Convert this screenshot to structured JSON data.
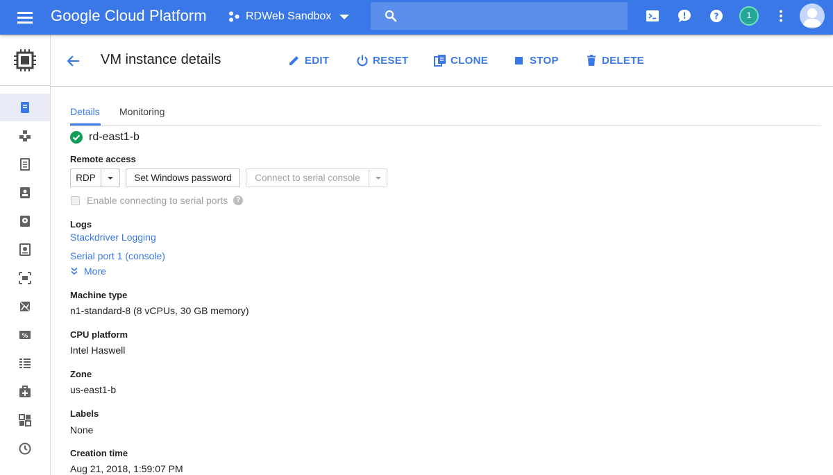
{
  "topbar": {
    "brand": "Google Cloud Platform",
    "project": "RDWeb Sandbox",
    "notification_count": "1",
    "color": "#3b78e7"
  },
  "rail": {
    "items": [
      {
        "icon": "vm-instances-icon",
        "active": true
      },
      {
        "icon": "instance-groups-icon"
      },
      {
        "icon": "instance-templates-icon"
      },
      {
        "icon": "sole-tenant-nodes-icon"
      },
      {
        "icon": "disks-icon"
      },
      {
        "icon": "snapshots-icon"
      },
      {
        "icon": "images-icon"
      },
      {
        "icon": "tpus-icon"
      },
      {
        "icon": "committed-use-discounts-icon"
      },
      {
        "icon": "metadata-icon"
      },
      {
        "icon": "health-checks-icon"
      },
      {
        "icon": "zones-icon"
      },
      {
        "icon": "operations-icon"
      }
    ]
  },
  "header": {
    "title": "VM instance details",
    "actions": {
      "edit": "EDIT",
      "reset": "RESET",
      "clone": "CLONE",
      "stop": "STOP",
      "delete": "DELETE"
    }
  },
  "tabs": {
    "details": "Details",
    "monitoring": "Monitoring"
  },
  "instance": {
    "name": "rd-east1-b",
    "status_color": "#0f9d58"
  },
  "remote_access": {
    "label": "Remote access",
    "rdp": "RDP",
    "set_password": "Set Windows password",
    "serial_console": "Connect to serial console",
    "enable_serial": "Enable connecting to serial ports",
    "help": "?"
  },
  "logs": {
    "label": "Logs",
    "stackdriver": "Stackdriver Logging",
    "serial_port": "Serial port 1 (console)",
    "more": "More"
  },
  "fields": {
    "machine_type_label": "Machine type",
    "machine_type": "n1-standard-8 (8 vCPUs, 30 GB memory)",
    "cpu_label": "CPU platform",
    "cpu": "Intel Haswell",
    "zone_label": "Zone",
    "zone": "us-east1-b",
    "labels_label": "Labels",
    "labels": "None",
    "creation_label": "Creation time",
    "creation": "Aug 21, 2018, 1:59:07 PM"
  }
}
